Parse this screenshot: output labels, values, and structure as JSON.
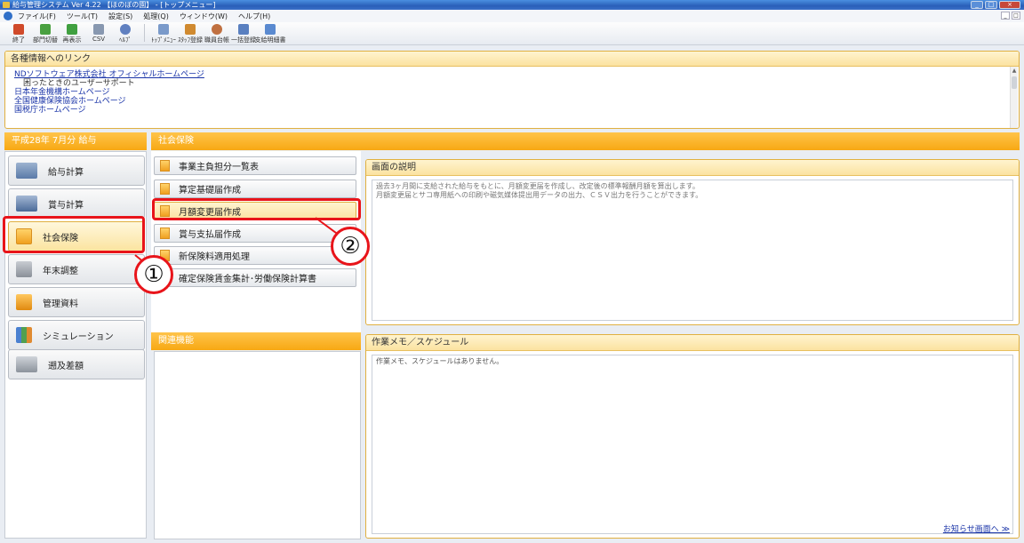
{
  "window": {
    "title": "給与管理システム  Ver 4.22 【ほのぼの園】 - [トップメニュー]",
    "controls": [
      "_",
      "□",
      "×"
    ]
  },
  "menubar": {
    "items": [
      "ファイル(F)",
      "ツール(T)",
      "設定(S)",
      "処理(Q)",
      "ウィンドウ(W)",
      "ヘルプ(H)"
    ]
  },
  "toolbar": {
    "items": [
      {
        "label": "終了",
        "icon": "exit-icon",
        "color": "#d04a2a"
      },
      {
        "label": "部門切替",
        "icon": "department-switch-icon",
        "color": "#4aa040"
      },
      {
        "label": "再表示",
        "icon": "refresh-icon",
        "color": "#40a040"
      },
      {
        "label": "CSV",
        "icon": "csv-icon",
        "color": "#8898b0"
      },
      {
        "label": "ﾍﾙﾌﾟ",
        "icon": "help-icon",
        "color": "#6080c0"
      },
      {
        "label": "ﾄｯﾌﾟﾒﾆｭｰ",
        "icon": "top-menu-icon",
        "color": "#7a9aca"
      },
      {
        "label": "ｽﾀｯﾌ登録",
        "icon": "staff-register-icon",
        "color": "#d08a30"
      },
      {
        "label": "職員台帳",
        "icon": "staff-ledger-icon",
        "color": "#c07040"
      },
      {
        "label": "一括登録",
        "icon": "bulk-register-icon",
        "color": "#5a80c0"
      },
      {
        "label": "支給明細書",
        "icon": "pay-slip-icon",
        "color": "#5a8ad0"
      }
    ]
  },
  "links": {
    "header": "各種情報へのリンク",
    "items": [
      {
        "text": "NDソフトウェア株式会社 オフィシャルホームページ",
        "style": "u"
      },
      {
        "text": "困ったときのユーザーサポート",
        "style": "indent"
      },
      {
        "text": "日本年金機構ホームページ",
        "style": ""
      },
      {
        "text": "全国健康保険協会ホームページ",
        "style": ""
      },
      {
        "text": "国税庁ホームページ",
        "style": ""
      }
    ]
  },
  "period_bar": "平成28年 7月分  給与",
  "section_bar": "社会保険",
  "nav": {
    "items": [
      {
        "label": "給与計算",
        "icon": "payroll-calc-icon",
        "active": false
      },
      {
        "label": "賞与計算",
        "icon": "bonus-calc-icon",
        "active": false
      },
      {
        "label": "社会保険",
        "icon": "social-insurance-icon",
        "active": true
      },
      {
        "label": "年末調整",
        "icon": "year-end-adjustment-icon",
        "active": false
      },
      {
        "label": "管理資料",
        "icon": "management-docs-icon",
        "active": false
      },
      {
        "label": "シミュレーション",
        "icon": "simulation-icon",
        "active": false
      },
      {
        "label": "遡及差額",
        "icon": "retroactive-diff-icon",
        "active": false
      }
    ]
  },
  "submenu": {
    "items": [
      "事業主負担分一覧表",
      "算定基礎届作成",
      "月額変更届作成",
      "賞与支払届作成",
      "新保険料適用処理",
      "確定保険賃金集計･労働保険計算書"
    ]
  },
  "related": {
    "header": "関連機能"
  },
  "description": {
    "header": "画面の説明",
    "line1": "過去3ヶ月間に支給された給与をもとに、月額変更届を作成し、改定後の標準報酬月額を算出します。",
    "line2": "月額変更届とサコ専用紙への印刷や磁気媒体提出用データの出力、ＣＳＶ出力を行うことができます。"
  },
  "memo": {
    "header": "作業メモ／スケジュール",
    "body": "作業メモ、スケジュールはありません。",
    "notice_link": "お知らせ画面へ ≫"
  },
  "annotations": {
    "circle1": "①",
    "circle2": "②",
    "color": "#e8141a"
  }
}
